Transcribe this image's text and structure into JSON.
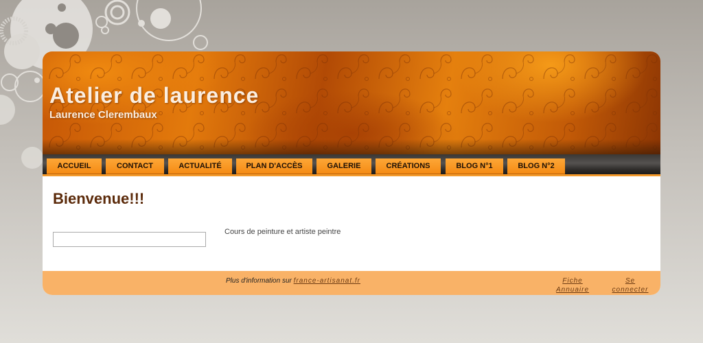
{
  "header": {
    "site_title": "Atelier de laurence",
    "site_subtitle": "Laurence Clerembaux"
  },
  "nav": {
    "items": [
      {
        "label": "ACCUEIL"
      },
      {
        "label": "CONTACT"
      },
      {
        "label": "ACTUALITÉ"
      },
      {
        "label": "PLAN D'ACCÈS"
      },
      {
        "label": "GALERIE"
      },
      {
        "label": "CRÉATIONS"
      },
      {
        "label": "BLOG N°1"
      },
      {
        "label": "BLOG N°2"
      }
    ]
  },
  "main": {
    "title": "Bienvenue!!!",
    "search_value": "",
    "description": "Cours de peinture et artiste peintre"
  },
  "footer": {
    "info_prefix": "Plus d'information sur",
    "info_link": "france-artisanat.fr",
    "fiche_line1": "Fiche",
    "fiche_line2": "Annuaire",
    "connect_line1": "Se",
    "connect_line2": "connecter"
  },
  "colors": {
    "banner_orange": "#e37a0c",
    "nav_tab": "#f58b14",
    "footer_bg": "#f9b267",
    "title_brown": "#5b2a0a"
  }
}
